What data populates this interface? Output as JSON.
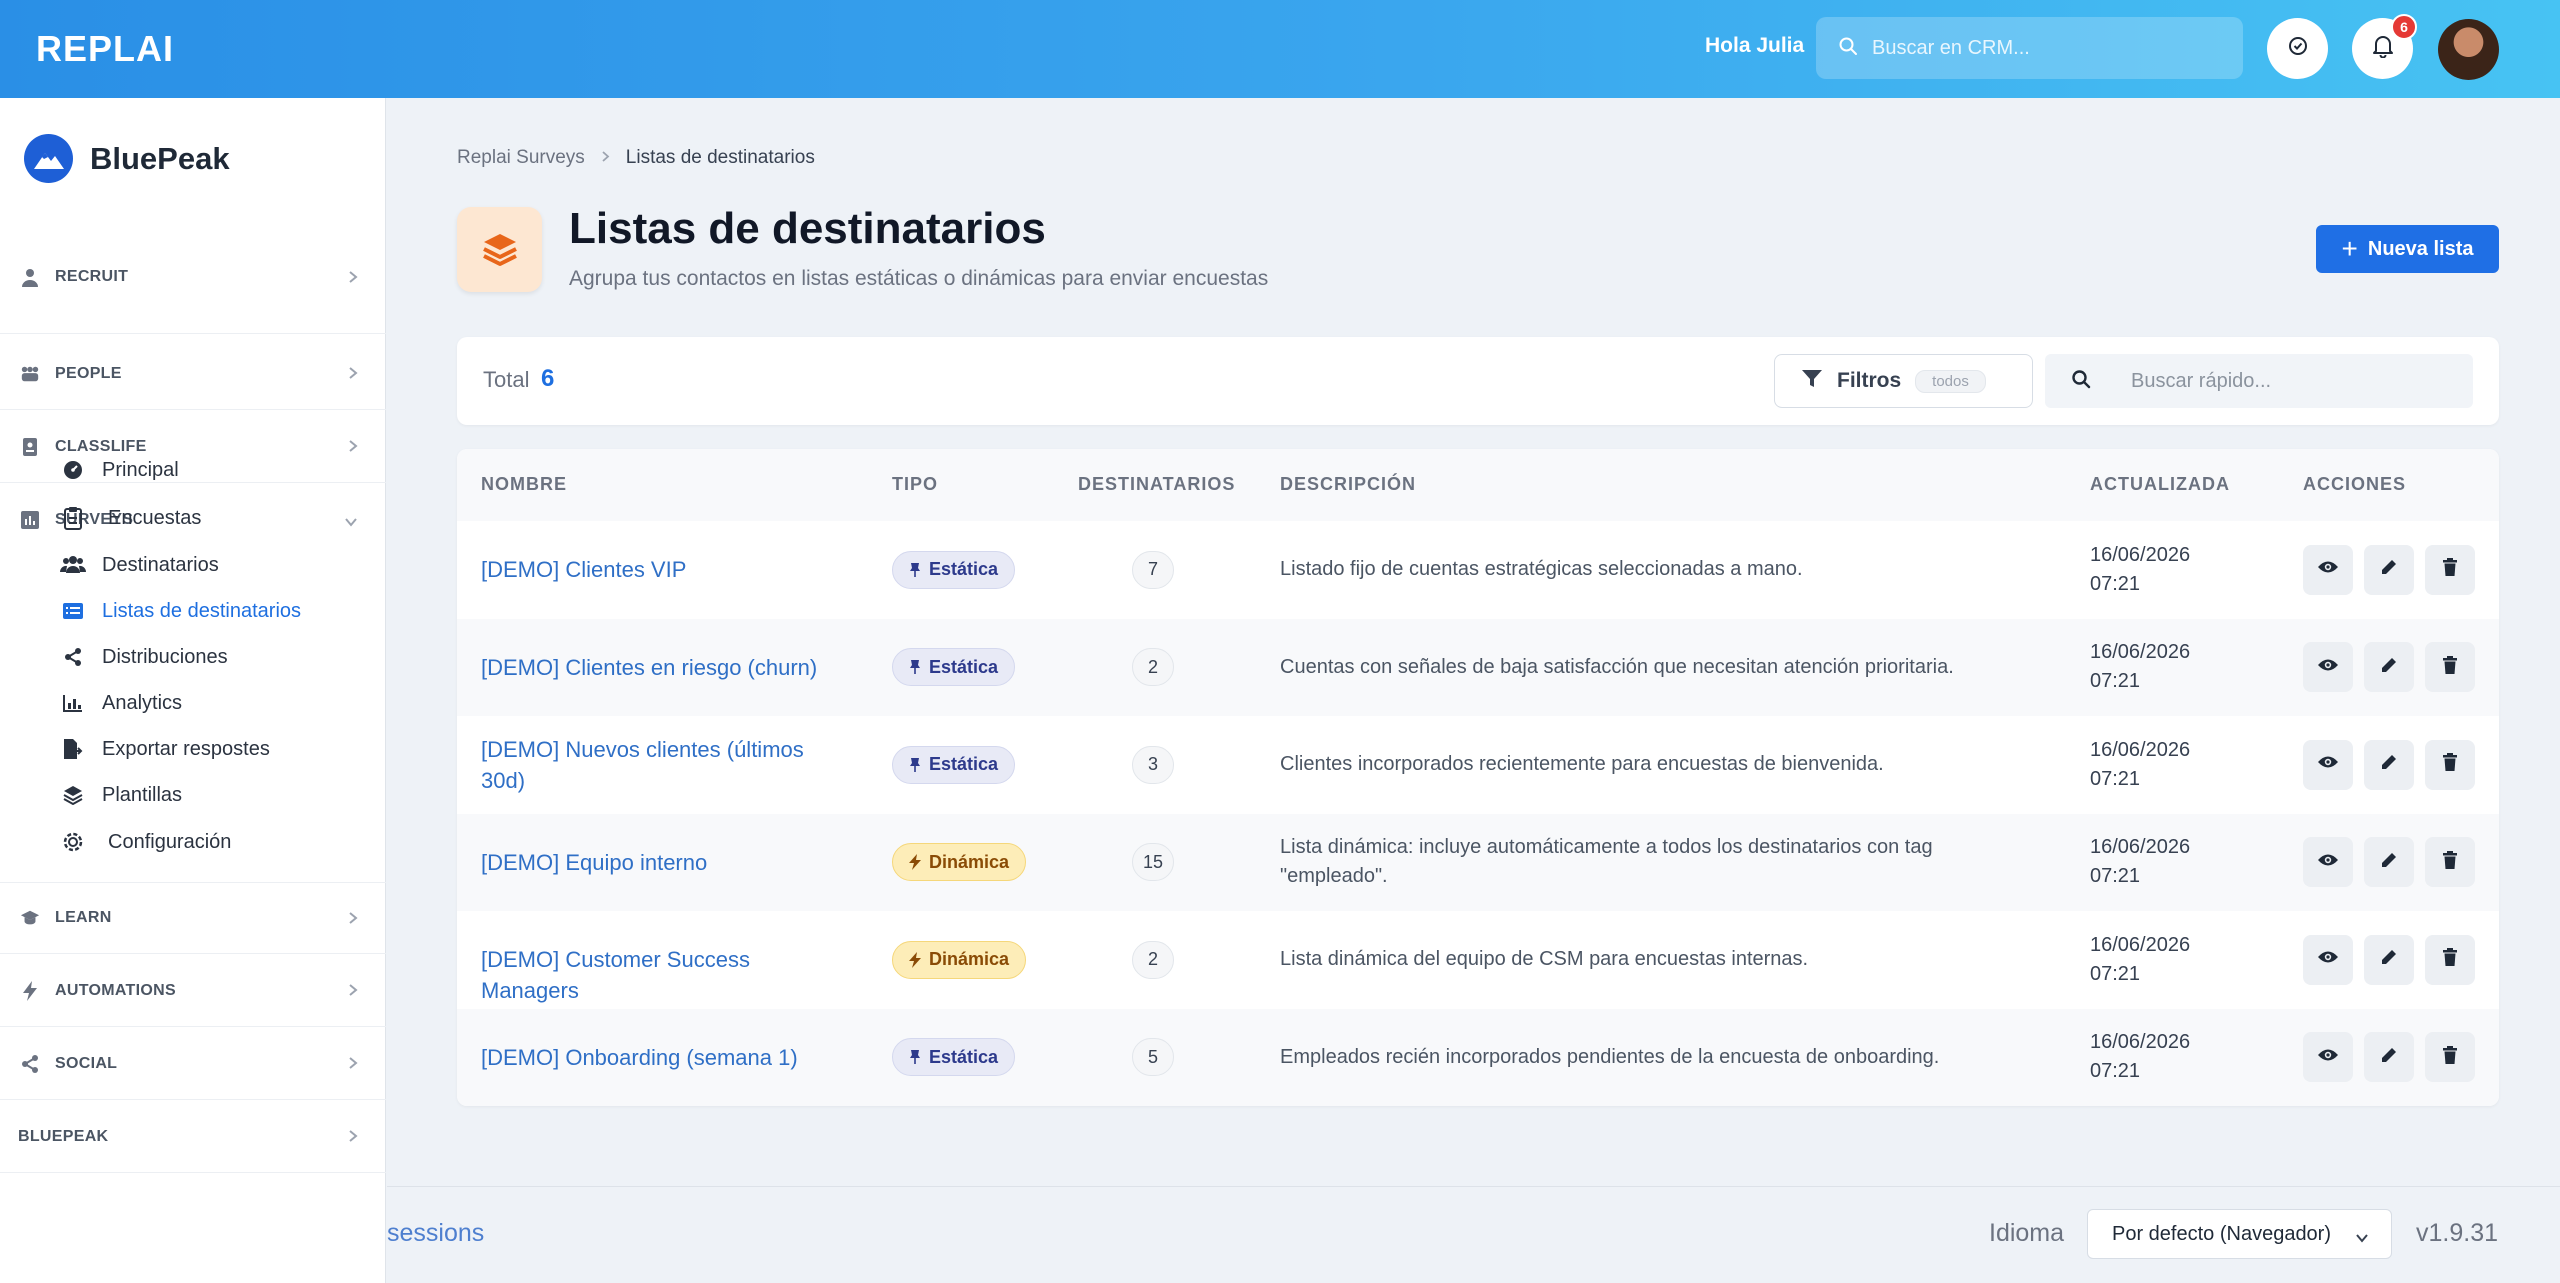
{
  "app": {
    "logo": "REPLAI"
  },
  "header": {
    "greeting": "Hola Julia",
    "search_placeholder": "Buscar en CRM...",
    "notifications_count": "6"
  },
  "sidebar": {
    "brand": "BluePeak",
    "sections": [
      {
        "label": "RECRUIT",
        "icon": "user-tie-icon"
      },
      {
        "label": "PEOPLE",
        "icon": "people-icon"
      },
      {
        "label": "CLASSLIFE",
        "icon": "id-badge-icon"
      },
      {
        "label": "SURVEYS",
        "icon": "chart-bar-icon"
      },
      {
        "label": "LEARN",
        "icon": "graduation-cap-icon"
      },
      {
        "label": "AUTOMATIONS",
        "icon": "bolt-icon"
      },
      {
        "label": "SOCIAL",
        "icon": "share-icon"
      },
      {
        "label": "BLUEPEAK",
        "icon": ""
      }
    ],
    "survey_items": [
      {
        "label": "Principal",
        "icon": "gauge-icon"
      },
      {
        "label": "Encuestas",
        "icon": "clipboard-icon"
      },
      {
        "label": "Destinatarios",
        "icon": "users-icon"
      },
      {
        "label": "Listas de destinatarios",
        "icon": "list-icon",
        "active": true
      },
      {
        "label": "Distribuciones",
        "icon": "share-icon"
      },
      {
        "label": "Analytics",
        "icon": "chart-line-icon"
      },
      {
        "label": "Exportar respostes",
        "icon": "file-export-icon"
      },
      {
        "label": "Plantillas",
        "icon": "layers-icon"
      },
      {
        "label": "Configuración",
        "icon": "gear-icon"
      }
    ]
  },
  "breadcrumb": {
    "parent": "Replai Surveys",
    "current": "Listas de destinatarios"
  },
  "page": {
    "title": "Listas de destinatarios",
    "subtitle": "Agrupa tus contactos en listas estáticas o dinámicas para enviar encuestas",
    "new_button": "Nueva lista"
  },
  "toolbar": {
    "total_label": "Total",
    "total_value": "6",
    "filters_label": "Filtros",
    "filters_pill": "todos",
    "search_placeholder": "Buscar rápido..."
  },
  "table": {
    "columns": [
      "NOMBRE",
      "TIPO",
      "DESTINATARIOS",
      "DESCRIPCIÓN",
      "ACTUALIZADA",
      "ACCIONES"
    ],
    "rows": [
      {
        "name": "[DEMO] Clientes VIP",
        "type": "Estática",
        "kind": "est",
        "count": "7",
        "desc": "Listado fijo de cuentas estratégicas seleccionadas a mano.",
        "date": "16/06/2026",
        "time": "07:21"
      },
      {
        "name": "[DEMO] Clientes en riesgo (churn)",
        "type": "Estática",
        "kind": "est",
        "count": "2",
        "desc": "Cuentas con señales de baja satisfacción que necesitan atención prioritaria.",
        "date": "16/06/2026",
        "time": "07:21"
      },
      {
        "name": "[DEMO] Nuevos clientes (últimos 30d)",
        "type": "Estática",
        "kind": "est",
        "count": "3",
        "desc": "Clientes incorporados recientemente para encuestas de bienvenida.",
        "date": "16/06/2026",
        "time": "07:21"
      },
      {
        "name": "[DEMO] Equipo interno",
        "type": "Dinámica",
        "kind": "din",
        "count": "15",
        "desc": "Lista dinámica: incluye automáticamente a todos los destinatarios con tag \"empleado\".",
        "date": "16/06/2026",
        "time": "07:21"
      },
      {
        "name": "[DEMO] Customer Success Managers",
        "type": "Dinámica",
        "kind": "din",
        "count": "2",
        "desc": "Lista dinámica del equipo de CSM para encuestas internas.",
        "date": "16/06/2026",
        "time": "07:21"
      },
      {
        "name": "[DEMO] Onboarding (semana 1)",
        "type": "Estática",
        "kind": "est",
        "count": "5",
        "desc": "Empleados recién incorporados pendientes de la encuesta de onboarding.",
        "date": "16/06/2026",
        "time": "07:21"
      }
    ]
  },
  "footer": {
    "sessions_text": "sessions",
    "language_label": "Idioma",
    "language_value": "Por defecto (Navegador)",
    "version": "v1.9.31"
  },
  "colors": {
    "primary": "#1f6fe5",
    "link": "#2f6fc6",
    "static_pill": "#e8eaf6",
    "dynamic_pill": "#fdedb8",
    "badge": "#e53935"
  }
}
